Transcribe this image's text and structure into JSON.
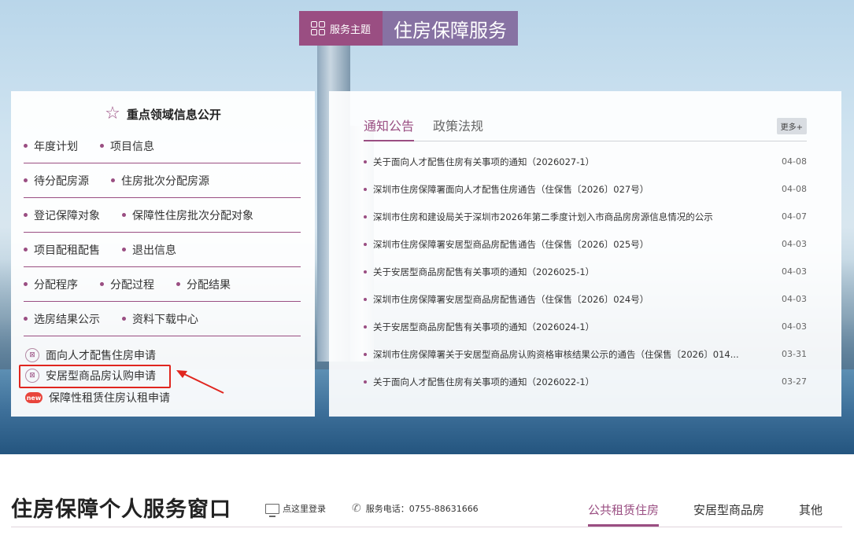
{
  "header": {
    "theme_label": "服务主题",
    "theme_title": "住房保障服务"
  },
  "focus": {
    "title": "重点领域信息公开",
    "rows": [
      [
        "年度计划",
        "项目信息"
      ],
      [
        "待分配房源",
        "住房批次分配房源"
      ],
      [
        "登记保障对象",
        "保障性住房批次分配对象"
      ],
      [
        "项目配租配售",
        "退出信息"
      ],
      [
        "分配程序",
        "分配过程",
        "分配结果"
      ],
      [
        "选房结果公示",
        "资料下载中心"
      ]
    ],
    "applications": [
      {
        "label": "面向人才配售住房申请",
        "icon": "apply-icon"
      },
      {
        "label": "安居型商品房认购申请",
        "icon": "apply-icon"
      },
      {
        "label": "保障性租赁住房认租申请",
        "icon": "new-badge-icon",
        "badge": "new"
      }
    ]
  },
  "news": {
    "tabs": [
      "通知公告",
      "政策法规"
    ],
    "active_tab": "通知公告",
    "more_label": "更多+",
    "items": [
      {
        "title": "关于面向人才配售住房有关事项的通知（2026027-1）",
        "date": "04-08"
      },
      {
        "title": "深圳市住房保障署面向人才配售住房通告（住保售〔2026〕027号）",
        "date": "04-08"
      },
      {
        "title": "深圳市住房和建设局关于深圳市2026年第二季度计划入市商品房房源信息情况的公示",
        "date": "04-07"
      },
      {
        "title": "深圳市住房保障署安居型商品房配售通告（住保售〔2026〕025号）",
        "date": "04-03"
      },
      {
        "title": "关于安居型商品房配售有关事项的通知（2026025-1）",
        "date": "04-03"
      },
      {
        "title": "深圳市住房保障署安居型商品房配售通告（住保售〔2026〕024号）",
        "date": "04-03"
      },
      {
        "title": "关于安居型商品房配售有关事项的通知（2026024-1）",
        "date": "04-03"
      },
      {
        "title": "深圳市住房保障署关于安居型商品房认购资格审核结果公示的通告（住保售〔2026〕014...",
        "date": "03-31"
      },
      {
        "title": "关于面向人才配售住房有关事项的通知（2026022-1）",
        "date": "03-27"
      }
    ]
  },
  "window": {
    "title": "住房保障个人服务窗口",
    "login_label": "点这里登录",
    "phone_label": "服务电话：0755-88631666",
    "tabs": [
      "公共租赁住房",
      "安居型商品房",
      "其他"
    ],
    "active_tab": "公共租赁住房"
  },
  "colors": {
    "accent": "#9a4e82",
    "title_bg": "#8772a3",
    "highlight": "#e0261f"
  }
}
